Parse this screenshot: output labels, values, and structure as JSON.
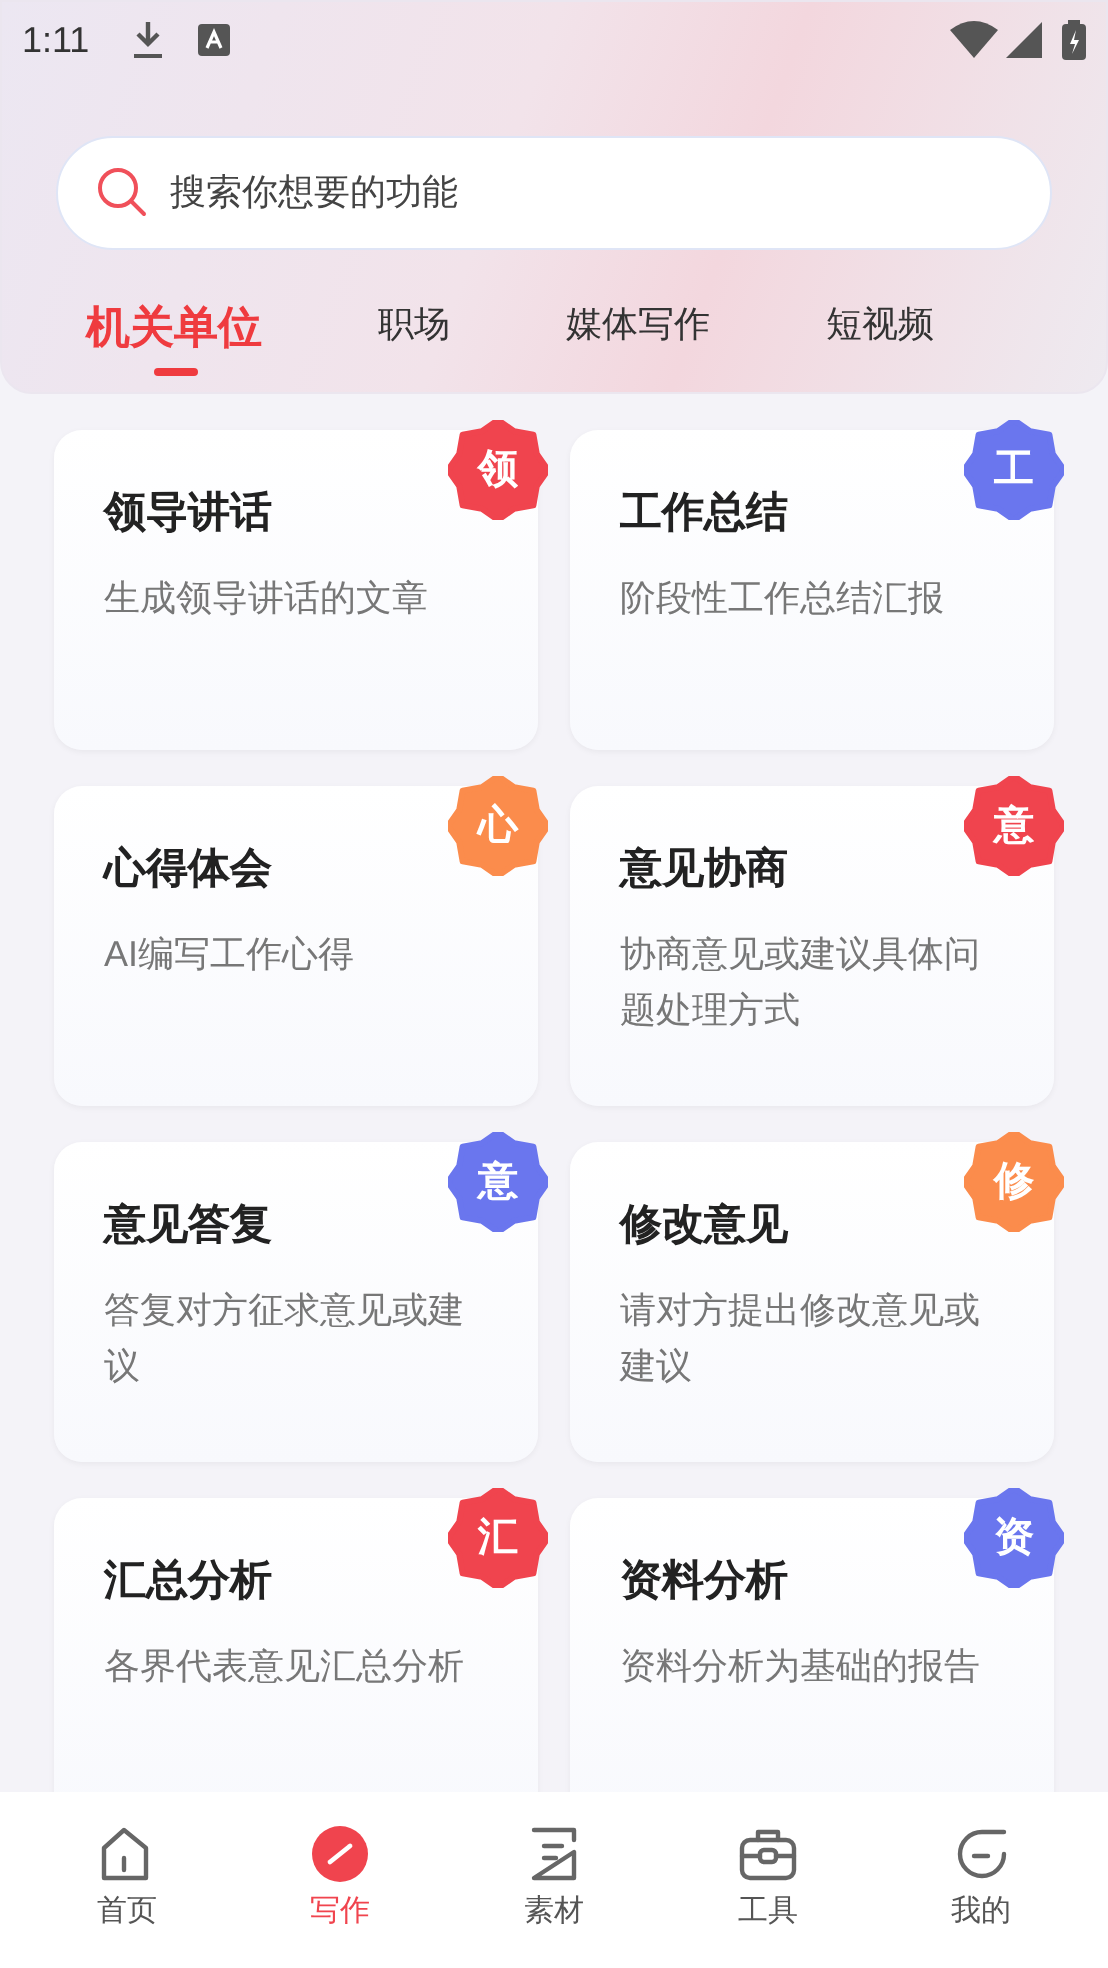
{
  "status_bar": {
    "time": "1:11"
  },
  "search": {
    "placeholder": "搜索你想要的功能"
  },
  "tabs": [
    {
      "label": "机关单位",
      "selected": true
    },
    {
      "label": "职场",
      "selected": false
    },
    {
      "label": "媒体写作",
      "selected": false
    },
    {
      "label": "短视频",
      "selected": false
    }
  ],
  "cards": [
    {
      "title": "领导讲话",
      "description": "生成领导讲话的文章",
      "badge": "领",
      "color": "#f0444e"
    },
    {
      "title": "工作总结",
      "description": "阶段性工作总结汇报",
      "badge": "工",
      "color": "#6a76ee"
    },
    {
      "title": "心得体会",
      "description": "AI编写工作心得",
      "badge": "心",
      "color": "#fb8c4c"
    },
    {
      "title": "意见协商",
      "description": "协商意见或建议具体问题处理方式",
      "badge": "意",
      "color": "#f0444e"
    },
    {
      "title": "意见答复",
      "description": "答复对方征求意见或建议",
      "badge": "意",
      "color": "#6a76ee"
    },
    {
      "title": "修改意见",
      "description": "请对方提出修改意见或建议",
      "badge": "修",
      "color": "#fb8c4c"
    },
    {
      "title": "汇总分析",
      "description": "各界代表意见汇总分析",
      "badge": "汇",
      "color": "#f0444e"
    },
    {
      "title": "资料分析",
      "description": "资料分析为基础的报告",
      "badge": "资",
      "color": "#6a76ee"
    }
  ],
  "nav": [
    {
      "label": "首页",
      "kind": "home",
      "selected": false
    },
    {
      "label": "写作",
      "kind": "write",
      "selected": true
    },
    {
      "label": "素材",
      "kind": "material",
      "selected": false
    },
    {
      "label": "工具",
      "kind": "tools",
      "selected": false
    },
    {
      "label": "我的",
      "kind": "me",
      "selected": false
    }
  ]
}
